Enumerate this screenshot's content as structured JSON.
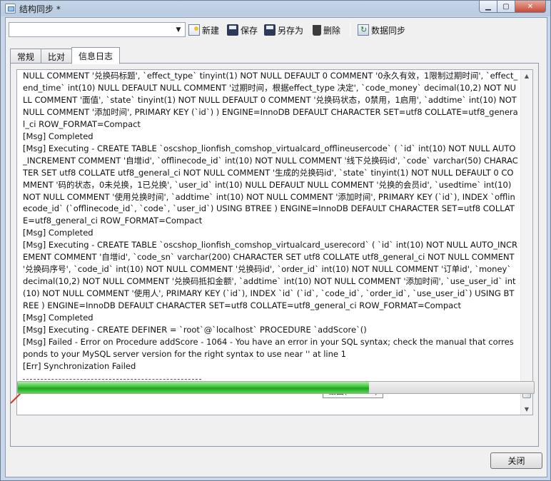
{
  "window": {
    "title": "结构同步 *",
    "controls": [
      "minimize-icon",
      "maximize-icon",
      "close-icon"
    ]
  },
  "toolbar": {
    "profile_value": "",
    "new_label": "新建",
    "save_label": "保存",
    "saveas_label": "另存为",
    "delete_label": "删除",
    "sync_label": "数据同步"
  },
  "tabs": [
    {
      "label": "常规",
      "active": false
    },
    {
      "label": "比对",
      "active": false
    },
    {
      "label": "信息日志",
      "active": true
    }
  ],
  "log": {
    "lines": [
      "NULL COMMENT '兑换码标题', `effect_type` tinyint(1) NOT NULL DEFAULT 0 COMMENT '0永久有效，1限制过期时间', `effect_end_time` int(10) NULL DEFAULT NULL COMMENT '过期时间，根据effect_type 决定', `code_money` decimal(10,2) NOT NULL COMMENT '面值', `state` tinyint(1) NOT NULL DEFAULT 0 COMMENT '兑换码状态，0禁用，1启用', `addtime` int(10) NOT NULL COMMENT '添加时间', PRIMARY KEY (`id`) ) ENGINE=InnoDB DEFAULT CHARACTER SET=utf8 COLLATE=utf8_general_ci ROW_FORMAT=Compact",
      "[Msg] Completed",
      "[Msg] Executing - CREATE TABLE `oscshop_lionfish_comshop_virtualcard_offlineusercode` ( `id` int(10) NOT NULL AUTO_INCREMENT COMMENT '自增id', `offlinecode_id` int(10) NOT NULL COMMENT '线下兑换码id', `code` varchar(50) CHARACTER SET utf8 COLLATE utf8_general_ci NOT NULL COMMENT '生成的兑换码id', `state` tinyint(1) NOT NULL DEFAULT 0 COMMENT '码的状态，0未兑换，1已兑换', `user_id` int(10) NULL DEFAULT NULL COMMENT '兑换的会员id', `usedtime` int(10) NOT NULL COMMENT '使用兑换时间', `addtime` int(10) NOT NULL COMMENT '添加时间', PRIMARY KEY (`id`), INDEX `offlinecode_id` (`offlinecode_id`, `code`, `user_id`) USING BTREE ) ENGINE=InnoDB DEFAULT CHARACTER SET=utf8 COLLATE=utf8_general_ci ROW_FORMAT=Compact",
      "[Msg] Completed",
      "[Msg] Executing - CREATE TABLE `oscshop_lionfish_comshop_virtualcard_userecord` ( `id` int(10) NOT NULL AUTO_INCREMENT COMMENT '自增id', `code_sn` varchar(200) CHARACTER SET utf8 COLLATE utf8_general_ci NOT NULL COMMENT '兑换码序号', `code_id` int(10) NOT NULL COMMENT '兑换码id', `order_id` int(10) NOT NULL COMMENT '订单id', `money` decimal(10,2) NOT NULL COMMENT '兑换码抵扣金额', `addtime` int(10) NOT NULL COMMENT '添加时间', `use_user_id` int(10) NOT NULL COMMENT '使用人', PRIMARY KEY (`id`), INDEX `id` (`id`, `code_id`, `order_id`, `use_user_id`) USING BTREE ) ENGINE=InnoDB DEFAULT CHARACTER SET=utf8 COLLATE=utf8_general_ci ROW_FORMAT=Compact",
      "[Msg] Completed",
      "[Msg] Executing - CREATE DEFINER = `root`@`localhost` PROCEDURE `addScore`()",
      "[Msg] Failed - Error on Procedure addScore - 1064 - You have an error in your SQL syntax; check the manual that corresponds to your MySQL server version for the right syntax to use near '' at line 1",
      "[Err] Synchronization Failed"
    ],
    "screenshot_tooltip": "截图(Alt + A)"
  },
  "progress": {
    "fraction": 0.68,
    "color": "#2db52c"
  },
  "footer": {
    "close_label": "关闭"
  },
  "colors": {
    "frame": "#c5d5e8",
    "panel": "#f0f0f0",
    "accent_red": "#d9362b"
  }
}
